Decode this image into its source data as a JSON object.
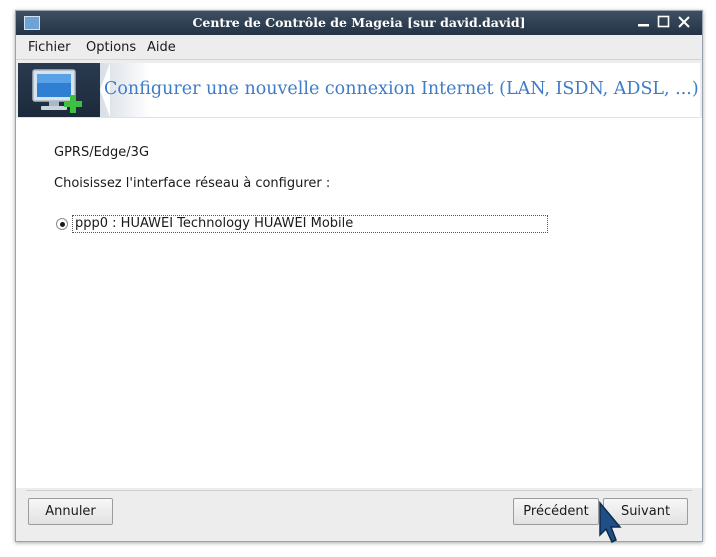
{
  "window": {
    "title": "Centre de Contrôle de Mageia  [sur david.david]",
    "controls": {
      "minimize": "minimize-icon",
      "maximize": "maximize-icon",
      "close": "close-icon"
    }
  },
  "menubar": {
    "items": [
      {
        "label": "Fichier"
      },
      {
        "label": "Options"
      },
      {
        "label": "Aide"
      }
    ]
  },
  "banner": {
    "icon": "network-monitor-add-icon",
    "heading": "Configurer une nouvelle connexion Internet (LAN, ISDN, ADSL, ...)"
  },
  "main": {
    "connection_type": "GPRS/Edge/3G",
    "prompt": "Choisissez l'interface réseau à configurer :",
    "options": [
      {
        "label": "ppp0 : HUAWEI Technology HUAWEI Mobile",
        "selected": true
      }
    ]
  },
  "buttons": {
    "cancel": "Annuler",
    "previous": "Précédent",
    "next": "Suivant"
  },
  "colors": {
    "heading": "#3d7cc9",
    "titlebar": "#243446",
    "accent_green": "#3fbf3f"
  }
}
